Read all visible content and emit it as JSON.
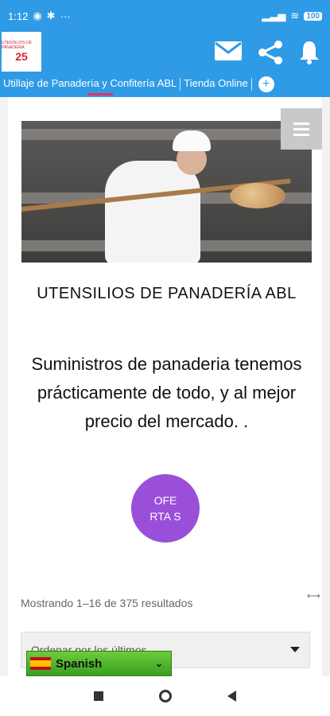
{
  "status": {
    "time": "1:12",
    "battery": "100",
    "dots": "···"
  },
  "app": {
    "logo_text": "25",
    "logo_mini": "UTENSILIOS DE PANADERÍA"
  },
  "tabs": [
    {
      "label": "Utillaje de Panadería y Confitería ABL"
    },
    {
      "label": "Tienda Online"
    }
  ],
  "page": {
    "title": "UTENSILIOS DE PANADERÍA ABL",
    "subtitle": "Suministros de panaderia tenemos prácticamente de todo, y al mejor precio del mercado. .",
    "offers_button": "OFE RTA S",
    "results": "Mostrando 1–16 de 375 resultados",
    "sort_value": "Ordenar por los últimos"
  },
  "language": {
    "selected": "Spanish"
  },
  "icons": {
    "mail": "mail-icon",
    "share": "share-icon",
    "bell": "bell-icon",
    "menu": "hamburger-icon",
    "add": "plus-icon"
  },
  "colors": {
    "appbar": "#2f9be6",
    "accent": "#e5335b",
    "offers": "#9a4fd9",
    "language_bar": "#4ab52a"
  }
}
